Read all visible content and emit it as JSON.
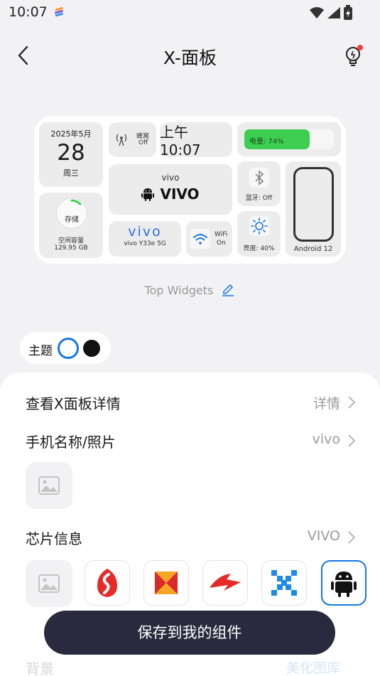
{
  "status_bar": {
    "time": "10:07",
    "icons": [
      "app-notification-icon",
      "wifi-icon",
      "cell-signal-icon",
      "battery-charging-icon"
    ]
  },
  "header": {
    "title": "X-面板",
    "back_icon": "chevron-left-icon",
    "tip_icon": "lightbulb-icon"
  },
  "widget_preview": {
    "date": {
      "year_month": "2025年5月",
      "day": "28",
      "weekday": "周三"
    },
    "cellular": {
      "label": "蜂窝",
      "status": "Off"
    },
    "time": "上午 10:07",
    "battery": {
      "label": "电量: 74%",
      "level_percent": 74,
      "color": "#3ecf52"
    },
    "device": {
      "brand": "vivo",
      "name": "VIVO"
    },
    "bluetooth": {
      "label": "蓝牙: Off"
    },
    "phone": {
      "os": "Android 12"
    },
    "storage": {
      "title": "存储",
      "capacity_label": "空闲容量",
      "capacity_value": "129.95 GB"
    },
    "model": {
      "logo": "vivo",
      "name": "vivo Y33e 5G"
    },
    "wifi": {
      "label": "WiFi",
      "status": "On"
    },
    "brightness": {
      "label": "亮度: 40%",
      "level_percent": 40
    }
  },
  "top_widgets_label": "Top Widgets",
  "theme": {
    "label": "主题",
    "options": [
      "white",
      "black"
    ],
    "selected": "white"
  },
  "settings": {
    "details": {
      "label": "查看X面板详情",
      "value": "详情"
    },
    "phone_name": {
      "label": "手机名称/照片",
      "value": "vivo"
    },
    "chip": {
      "label": "芯片信息",
      "value": "VIVO"
    },
    "background": {
      "label": "背景",
      "value": "美化图库"
    }
  },
  "chip_options": [
    {
      "name": "image-placeholder",
      "selected": false
    },
    {
      "name": "snapdragon",
      "selected": false
    },
    {
      "name": "helio",
      "selected": false
    },
    {
      "name": "kirin",
      "selected": false
    },
    {
      "name": "exynos",
      "selected": false
    },
    {
      "name": "android",
      "selected": true
    }
  ],
  "save_button": "保存到我的组件",
  "colors": {
    "accent": "#1677e5",
    "button_bg": "#2a2a3e",
    "sheet_bg": "#ffffff",
    "page_bg": "#f2f2f4"
  }
}
